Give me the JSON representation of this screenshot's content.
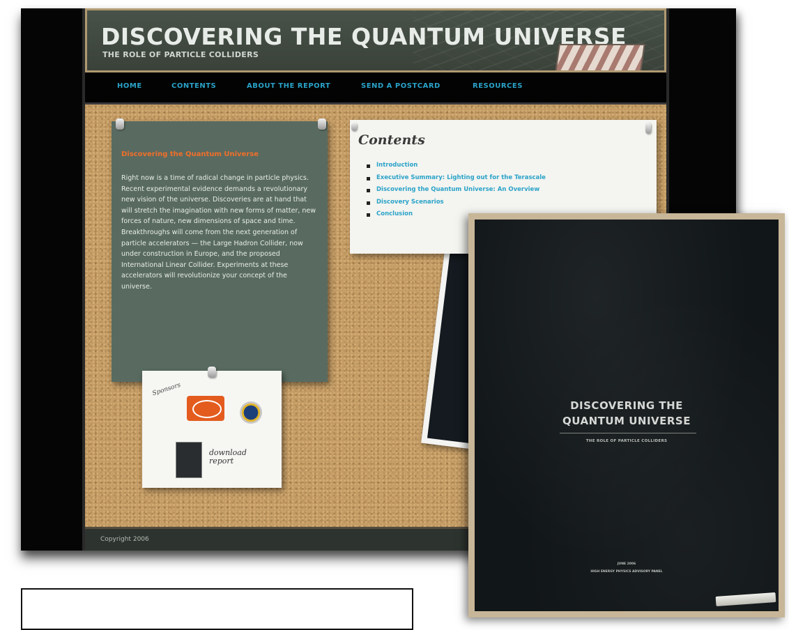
{
  "site": {
    "title": "DISCOVERING THE QUANTUM UNIVERSE",
    "subtitle": "THE ROLE OF PARTICLE COLLIDERS",
    "nav": [
      "HOME",
      "CONTENTS",
      "ABOUT THE REPORT",
      "SEND A POSTCARD",
      "RESOURCES"
    ],
    "intro": {
      "title": "Discovering the Quantum Universe",
      "text": "Right now is a time of radical change in particle physics. Recent experimental evidence demands a revolutionary new vision of the universe. Discoveries are at hand that will stretch the imagination with new forms of matter, new forces of nature, new dimensions of space and time. Breakthroughs will come from the next generation of particle accelerators — the Large Hadron Collider, now under construction in Europe, and the proposed International Linear Collider. Experiments at these accelerators will revolutionize your concept of the universe."
    },
    "contents": {
      "heading": "Contents",
      "items": [
        "Introduction",
        "Executive Summary: Lighting out for the Terascale",
        "Discovering the Quantum Universe: An Overview",
        "Discovery Scenarios",
        "Conclusion"
      ]
    },
    "sponsors": {
      "label": "Sponsors",
      "download": "download report"
    },
    "footer": {
      "copyright": "Copyright 2006"
    }
  },
  "cover": {
    "title_line1": "DISCOVERING THE",
    "title_line2": "QUANTUM UNIVERSE",
    "subtitle": "THE ROLE OF PARTICLE COLLIDERS",
    "date": "JUNE 2006",
    "publisher": "HIGH ENERGY PHYSICS ADVISORY PANEL"
  },
  "colors": {
    "link": "#2aa3c9",
    "intro_title": "#f06f2a",
    "card": "#596b60",
    "cork": "#c49b64"
  }
}
